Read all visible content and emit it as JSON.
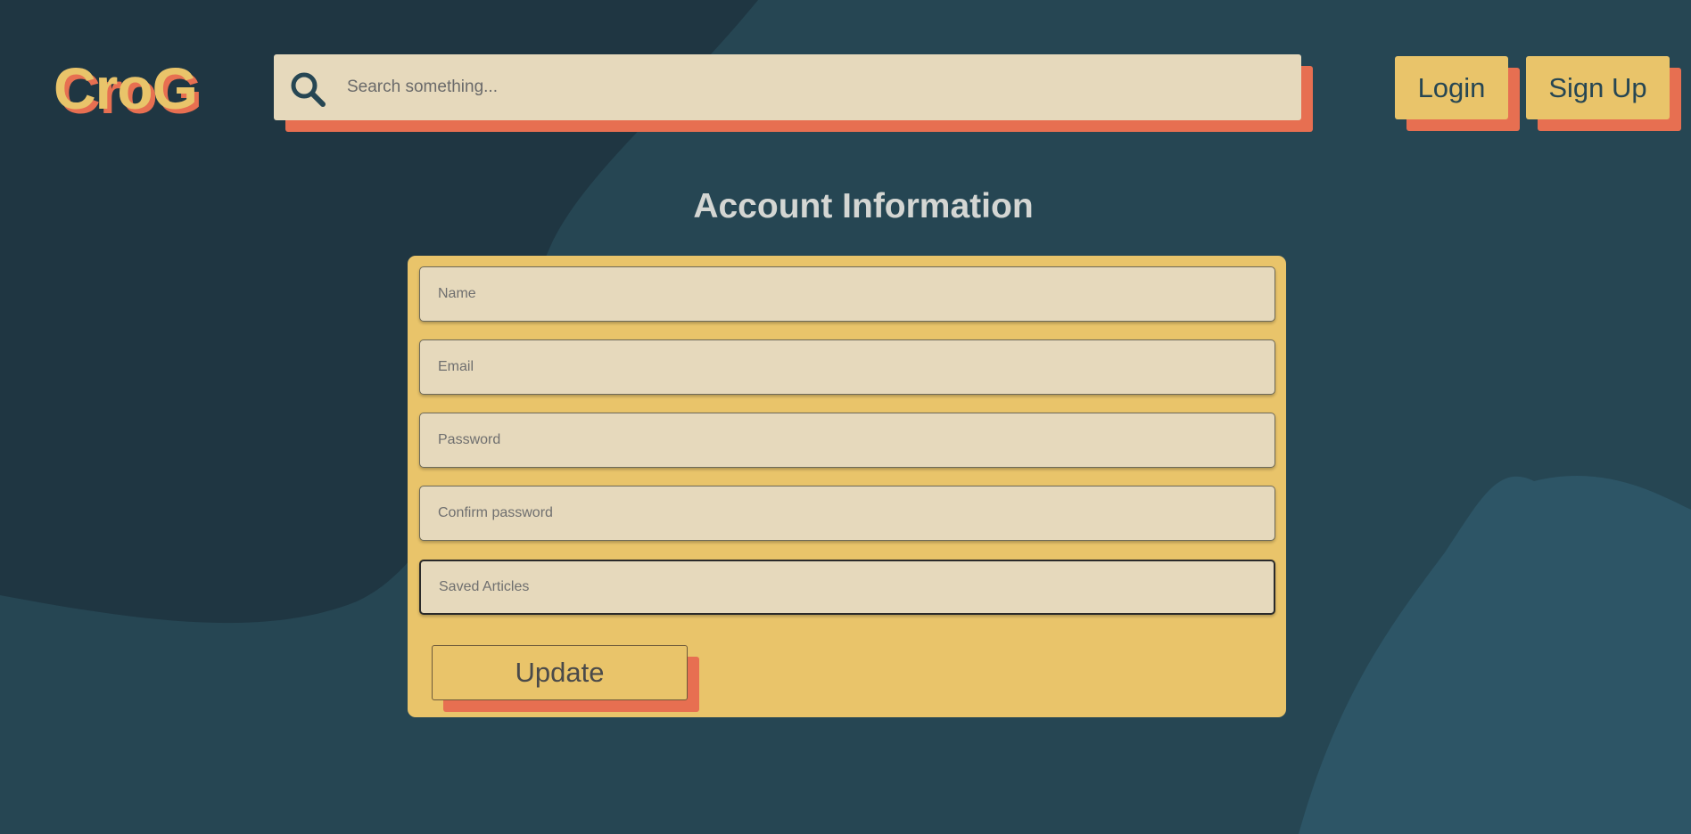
{
  "brand": {
    "logo_text": "CroG"
  },
  "header": {
    "search_placeholder": "Search something...",
    "login_label": "Login",
    "signup_label": "Sign Up"
  },
  "main": {
    "title": "Account Information",
    "fields": {
      "name_placeholder": "Name",
      "email_placeholder": "Email",
      "password_placeholder": "Password",
      "confirm_password_placeholder": "Confirm password",
      "saved_articles_placeholder": "Saved Articles"
    },
    "update_label": "Update"
  },
  "colors": {
    "background": "#264653",
    "accent_yellow": "#e9c46a",
    "accent_coral": "#e76f51",
    "input_fill": "#e6d9bc",
    "title_text": "#d4d6d3"
  },
  "icons": {
    "search": "magnifier-icon"
  }
}
